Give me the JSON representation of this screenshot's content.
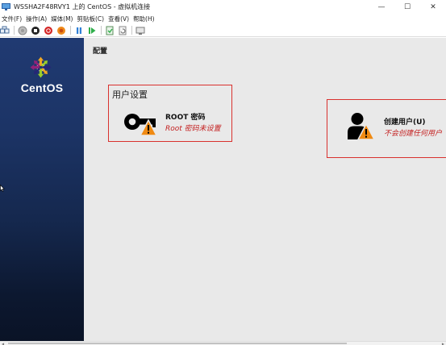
{
  "window": {
    "title": "WSSHA2F48RVY1 上的 CentOS - 虚拟机连接",
    "minimize_glyph": "—",
    "maximize_glyph": "☐",
    "close_glyph": "✕"
  },
  "menu": {
    "items": [
      {
        "label": "文件(F)"
      },
      {
        "label": "操作(A)"
      },
      {
        "label": "媒体(M)"
      },
      {
        "label": "剪贴板(C)"
      },
      {
        "label": "查看(V)"
      },
      {
        "label": "帮助(H)"
      }
    ]
  },
  "toolbar": {
    "icons": [
      "ctrl-alt-del-icon",
      "start-icon",
      "turn-off-icon",
      "shutdown-icon",
      "save-icon",
      "pause-icon",
      "resume-icon",
      "checkpoint-icon",
      "revert-icon",
      "enhanced-session-icon"
    ]
  },
  "sidebar": {
    "brand": "CentOS"
  },
  "main": {
    "page_title": "配置",
    "user_settings": {
      "title": "用户设置",
      "root_password": {
        "name": "ROOT 密码",
        "status": "Root 密码未设置"
      }
    },
    "create_user": {
      "name": "创建用户(U)",
      "status": "不会创建任何用户"
    }
  },
  "colors": {
    "sidebar_top": "#203a72",
    "sidebar_bottom": "#0a1326",
    "main_bg": "#e9e9e9",
    "error_border": "#d9312e",
    "status_text": "#c42121",
    "warning": "#f08a12"
  }
}
